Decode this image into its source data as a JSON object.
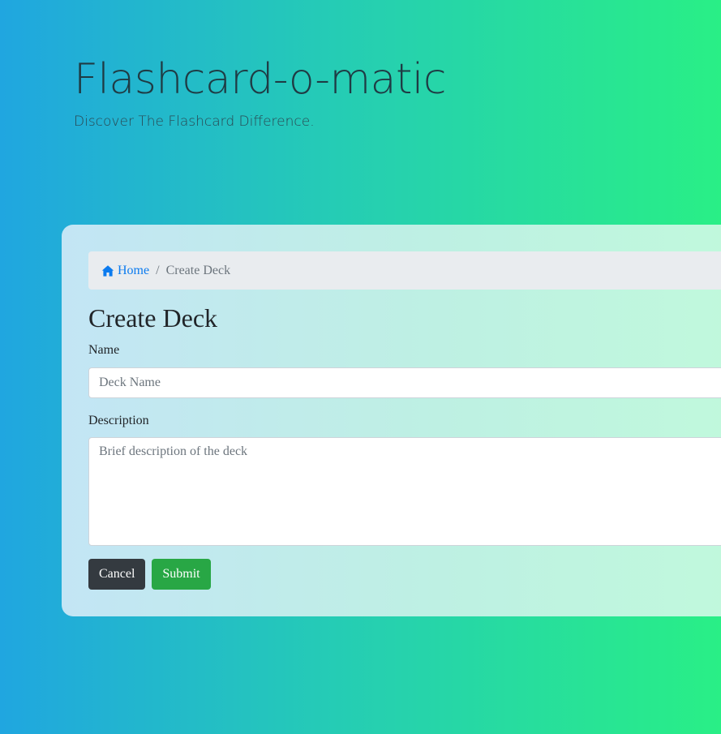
{
  "header": {
    "title": "Flashcard-o-matic",
    "tagline": "Discover The Flashcard Difference."
  },
  "breadcrumb": {
    "home_icon": "home-icon",
    "home_label": "Home",
    "separator": "/",
    "current": "Create Deck"
  },
  "form": {
    "heading": "Create Deck",
    "name_label": "Name",
    "name_placeholder": "Deck Name",
    "name_value": "",
    "description_label": "Description",
    "description_placeholder": "Brief description of the deck",
    "description_value": "",
    "cancel_label": "Cancel",
    "submit_label": "Submit"
  },
  "colors": {
    "link": "#0b7bef",
    "cancel_button": "#343a40",
    "submit_button": "#28a745",
    "breadcrumb_bg": "#e9ecef"
  }
}
